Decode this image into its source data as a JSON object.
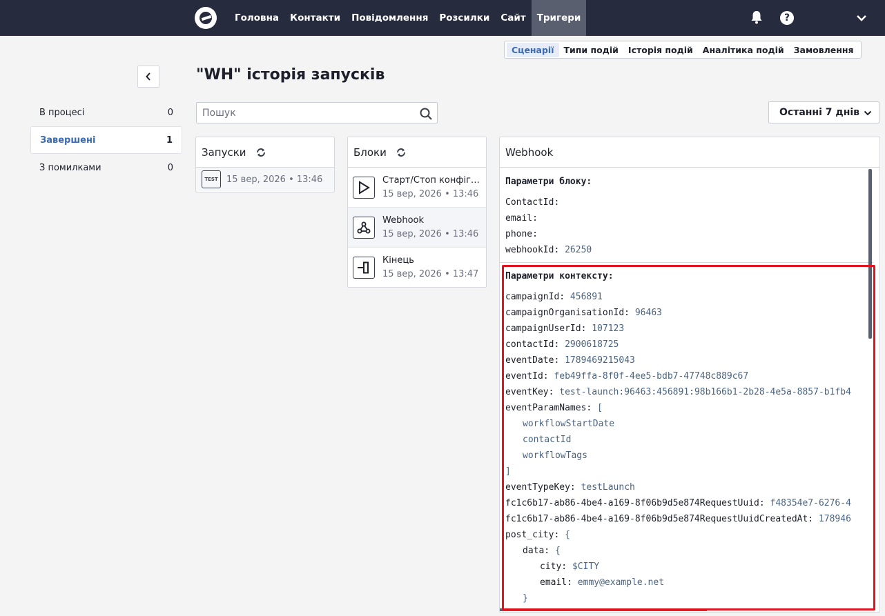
{
  "nav": {
    "items": [
      {
        "label": "Головна",
        "active": false
      },
      {
        "label": "Контакти",
        "active": false
      },
      {
        "label": "Повідомлення",
        "active": false
      },
      {
        "label": "Розсилки",
        "active": false
      },
      {
        "label": "Сайт",
        "active": false
      },
      {
        "label": "Тригери",
        "active": true
      }
    ],
    "help_glyph": "?"
  },
  "subtabs": [
    {
      "label": "Сценарії",
      "active": true
    },
    {
      "label": "Типи подій",
      "active": false
    },
    {
      "label": "Історія подій",
      "active": false
    },
    {
      "label": "Аналітика подій",
      "active": false
    },
    {
      "label": "Замовлення",
      "active": false
    }
  ],
  "page": {
    "title": "\"WH\" історія запусків"
  },
  "filters": [
    {
      "label": "В процесі",
      "count": "0",
      "active": false
    },
    {
      "label": "Завершені",
      "count": "1",
      "active": true
    },
    {
      "label": "З помилками",
      "count": "0",
      "active": false
    }
  ],
  "search": {
    "placeholder": "Пошук",
    "value": ""
  },
  "period": {
    "label": "Останні 7 днів"
  },
  "runs_panel": {
    "title": "Запуски",
    "runs": [
      {
        "badge": "TEST",
        "date": "15 вер, 2026 • 13:46"
      }
    ]
  },
  "blocks_panel": {
    "title": "Блоки",
    "blocks": [
      {
        "icon": "play-icon",
        "name": "Старт/Стоп конфігурації",
        "date": "15 вер, 2026 • 13:46",
        "active": false
      },
      {
        "icon": "webhook-icon",
        "name": "Webhook",
        "date": "15 вер, 2026 • 13:46",
        "active": true
      },
      {
        "icon": "end-icon",
        "name": "Кінець",
        "date": "15 вер, 2026 • 13:47",
        "active": false
      }
    ]
  },
  "webhook_panel": {
    "title": "Webhook",
    "block_params_title": "Параметри блоку:",
    "block_params": [
      {
        "k": "ContactId:",
        "v": ""
      },
      {
        "k": "email:",
        "v": ""
      },
      {
        "k": "phone:",
        "v": ""
      },
      {
        "k": "webhookId:",
        "v": "26250"
      }
    ],
    "context_params_title": "Параметри контексту:",
    "context_lines": [
      {
        "indent": 0,
        "k": "campaignId:",
        "v": "456891"
      },
      {
        "indent": 0,
        "k": "campaignOrganisationId:",
        "v": "96463"
      },
      {
        "indent": 0,
        "k": "campaignUserId:",
        "v": "107123"
      },
      {
        "indent": 0,
        "k": "contactId:",
        "v": "2900618725"
      },
      {
        "indent": 0,
        "k": "eventDate:",
        "v": "1789469215043"
      },
      {
        "indent": 0,
        "k": "eventId:",
        "v": "feb49ffa-8f0f-4ee5-bdb7-47748c889c67"
      },
      {
        "indent": 0,
        "k": "eventKey:",
        "v": "test-launch:96463:456891:98b166b1-2b28-4e5a-8857-b1fb4"
      },
      {
        "indent": 0,
        "k": "eventParamNames:",
        "v": "["
      },
      {
        "indent": 1,
        "k": "",
        "v": "workflowStartDate"
      },
      {
        "indent": 1,
        "k": "",
        "v": "contactId"
      },
      {
        "indent": 1,
        "k": "",
        "v": "workflowTags"
      },
      {
        "indent": 0,
        "k": "",
        "v": "]"
      },
      {
        "indent": 0,
        "k": "eventTypeKey:",
        "v": "testLaunch"
      },
      {
        "indent": 0,
        "k": "fc1c6b17-ab86-4be4-a169-8f06b9d5e874RequestUuid:",
        "v": "f48354e7-6276-4"
      },
      {
        "indent": 0,
        "k": "fc1c6b17-ab86-4be4-a169-8f06b9d5e874RequestUuidCreatedAt:",
        "v": "178946"
      },
      {
        "indent": 0,
        "k": "post_city:",
        "v": "{"
      },
      {
        "indent": 1,
        "k": "data:",
        "v": "{"
      },
      {
        "indent": 2,
        "k": "city:",
        "v": "$CITY"
      },
      {
        "indent": 2,
        "k": "email:",
        "v": "emmy@example.net"
      },
      {
        "indent": 1,
        "k": "",
        "v": "}"
      }
    ]
  },
  "colors": {
    "topbar": "#262b3d",
    "accent": "#3a6bb4",
    "highlight": "#e0141e"
  }
}
